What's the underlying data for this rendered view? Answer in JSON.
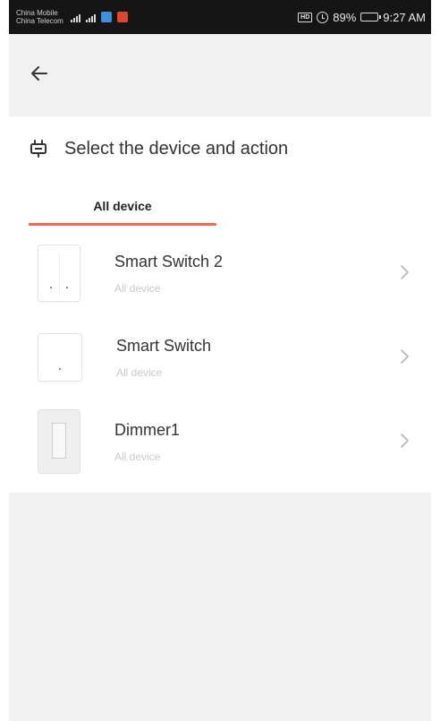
{
  "status_bar": {
    "carrier_1": "China Mobile",
    "carrier_2": "China Telecom",
    "hd": "HD",
    "battery": "89%",
    "time": "9:27 AM"
  },
  "header": {
    "back_icon": "arrow-left-icon"
  },
  "section": {
    "title": "Select the device and action",
    "icon": "plug-icon"
  },
  "tabs": [
    {
      "label": "All device",
      "active": true
    }
  ],
  "devices": [
    {
      "name": "Smart Switch 2",
      "subtitle": "All device",
      "icon": "double-switch-icon"
    },
    {
      "name": "Smart Switch",
      "subtitle": "All device",
      "icon": "single-switch-icon"
    },
    {
      "name": "Dimmer1",
      "subtitle": "All device",
      "icon": "dimmer-switch-icon"
    }
  ],
  "colors": {
    "accent": "#ee6a4a",
    "background": "#f1f1f1",
    "status_bar": "#151515"
  }
}
